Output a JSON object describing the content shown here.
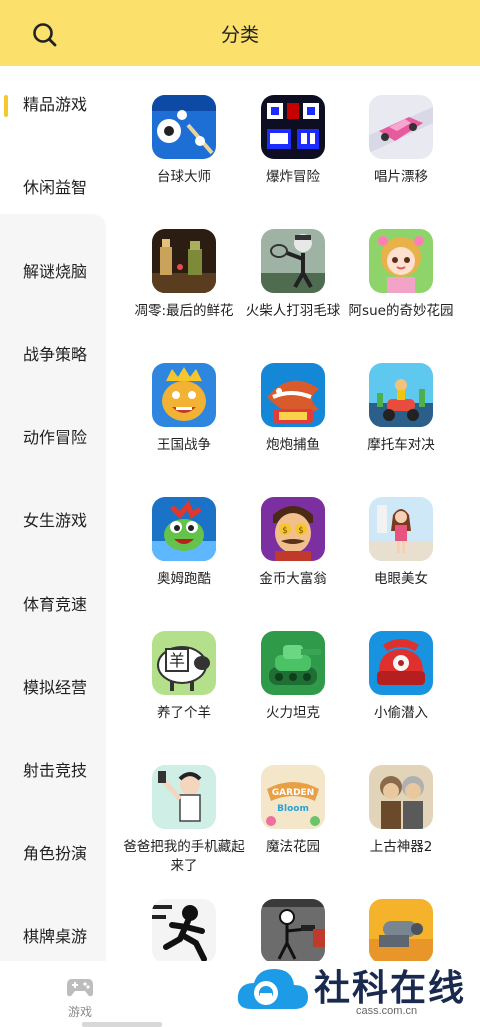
{
  "header": {
    "title": "分类",
    "search_icon": "search-icon"
  },
  "sidebar": {
    "active_index": 0,
    "items": [
      {
        "label": "精品游戏"
      },
      {
        "label": "休闲益智"
      },
      {
        "label": "解谜烧脑"
      },
      {
        "label": "战争策略"
      },
      {
        "label": "动作冒险"
      },
      {
        "label": "女生游戏"
      },
      {
        "label": "体育竞速"
      },
      {
        "label": "模拟经营"
      },
      {
        "label": "射击竞技"
      },
      {
        "label": "角色扮演"
      },
      {
        "label": "棋牌桌游"
      }
    ]
  },
  "games": [
    {
      "name": "台球大师",
      "icon": "billiards-icon"
    },
    {
      "name": "爆炸冒险",
      "icon": "bomb-adventure-icon"
    },
    {
      "name": "唱片漂移",
      "icon": "drift-car-icon"
    },
    {
      "name": "凋零:最后的鲜花",
      "icon": "withered-flower-icon"
    },
    {
      "name": "火柴人打羽毛球",
      "icon": "stickman-badminton-icon"
    },
    {
      "name": "阿sue的奇妙花园",
      "icon": "sue-garden-icon"
    },
    {
      "name": "王国战争",
      "icon": "kingdom-war-icon"
    },
    {
      "name": "炮炮捕鱼",
      "icon": "fish-shooting-icon"
    },
    {
      "name": "摩托车对决",
      "icon": "motorcycle-duel-icon"
    },
    {
      "name": "奥姆跑酷",
      "icon": "om-nom-run-icon"
    },
    {
      "name": "金币大富翁",
      "icon": "gold-tycoon-icon"
    },
    {
      "name": "电眼美女",
      "icon": "electric-eye-girl-icon"
    },
    {
      "name": "养了个羊",
      "icon": "sheep-icon"
    },
    {
      "name": "火力坦克",
      "icon": "tank-icon"
    },
    {
      "name": "小偷潜入",
      "icon": "thief-phone-icon"
    },
    {
      "name": "爸爸把我的手机藏起来了",
      "icon": "hidden-phone-icon"
    },
    {
      "name": "魔法花园",
      "icon": "garden-bloom-icon"
    },
    {
      "name": "上古神器2",
      "icon": "ancient-artifact-icon"
    },
    {
      "name": "",
      "icon": "stickman-run-icon"
    },
    {
      "name": "",
      "icon": "stickman-gun-icon"
    },
    {
      "name": "",
      "icon": "cannon-icon"
    }
  ],
  "bottom_nav": {
    "tab_label": "游戏",
    "tab_icon": "gamepad-icon"
  },
  "watermark": {
    "main": "社科在线",
    "sub": "cass.com.cn"
  }
}
